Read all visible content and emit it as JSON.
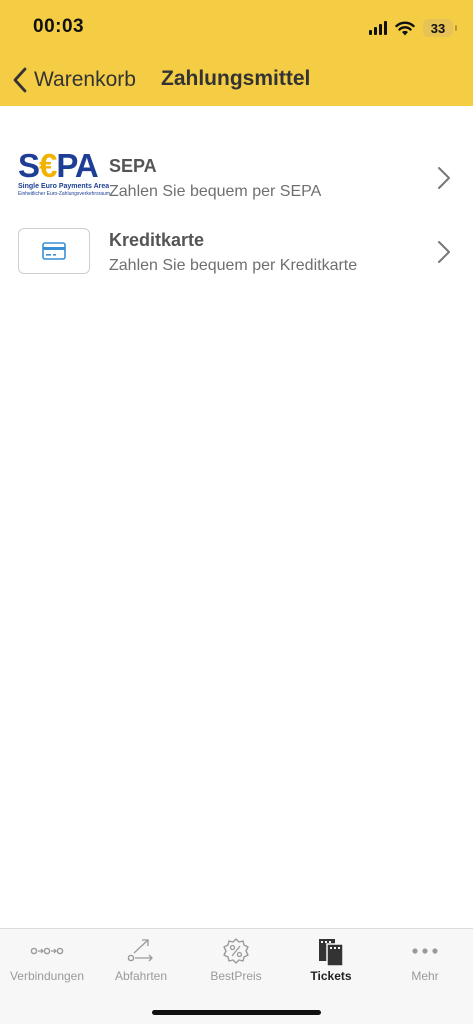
{
  "status": {
    "time": "00:03",
    "battery": "33"
  },
  "nav": {
    "back_label": "Warenkorb",
    "title": "Zahlungsmittel"
  },
  "payment_methods": [
    {
      "title": "SEPA",
      "subtitle": "Zahlen Sie bequem per SEPA",
      "logo": {
        "text_s": "S",
        "text_euro": "€",
        "text_pa": "PA",
        "line1": "Single Euro Payments Area",
        "line2": "Einheitlicher Euro-Zahlungsverkehrsraum"
      }
    },
    {
      "title": "Kreditkarte",
      "subtitle": "Zahlen Sie bequem per Kreditkarte"
    }
  ],
  "tabs": [
    {
      "label": "Verbindungen",
      "icon": "connections-icon",
      "active": false
    },
    {
      "label": "Abfahrten",
      "icon": "departures-icon",
      "active": false
    },
    {
      "label": "BestPreis",
      "icon": "percent-badge-icon",
      "active": false
    },
    {
      "label": "Tickets",
      "icon": "tickets-icon",
      "active": true
    },
    {
      "label": "Mehr",
      "icon": "more-dots-icon",
      "active": false
    }
  ],
  "colors": {
    "header": "#f5cd45",
    "sepa_blue": "#1d3e94",
    "sepa_yellow": "#f2b300",
    "card_icon": "#3a8fd6"
  }
}
